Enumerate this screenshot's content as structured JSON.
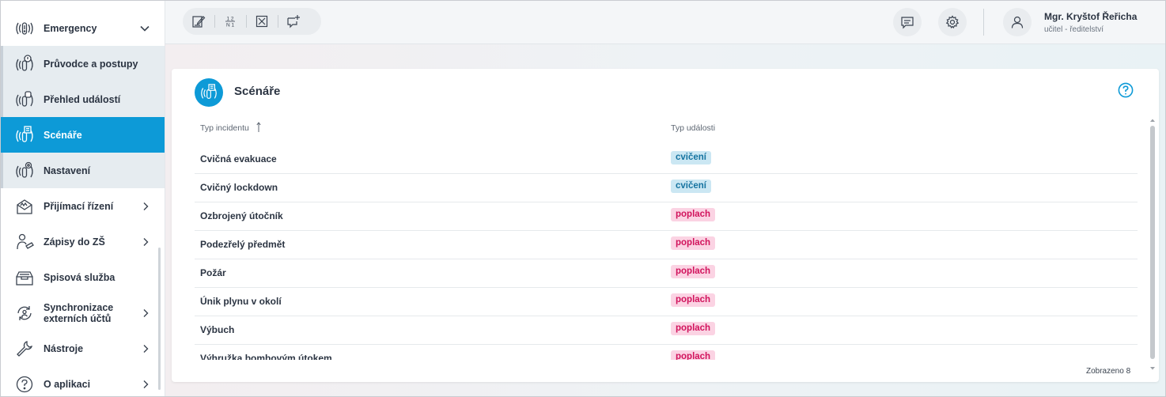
{
  "sidebar": {
    "items": [
      {
        "label": "Emergency",
        "icon": "emergency-icon"
      },
      {
        "label": "Průvodce a postupy",
        "icon": "guide-icon"
      },
      {
        "label": "Přehled událostí",
        "icon": "events-icon"
      },
      {
        "label": "Scénáře",
        "icon": "scenarios-icon"
      },
      {
        "label": "Nastavení",
        "icon": "settings-emergency-icon"
      },
      {
        "label": "Přijímací řízení",
        "icon": "admission-icon"
      },
      {
        "label": "Zápisy do ZŠ",
        "icon": "enrollment-icon"
      },
      {
        "label": "Spisová služba",
        "icon": "filing-icon"
      },
      {
        "label": "Synchronizace externích účtů",
        "icon": "sync-icon"
      },
      {
        "label": "Nástroje",
        "icon": "wrench-icon"
      },
      {
        "label": "O aplikaci",
        "icon": "question-icon"
      }
    ]
  },
  "topbar": {
    "tools": [
      "edit-icon",
      "grades-icon",
      "absence-icon",
      "add-message-icon"
    ],
    "user": {
      "name": "Mgr. Kryštof Řeřicha",
      "role": "učitel - ředitelství"
    }
  },
  "card": {
    "title": "Scénáře",
    "columns": {
      "type": "Typ incidentu",
      "event": "Typ události"
    },
    "rows": [
      {
        "name": "Cvičná evakuace",
        "badge": "cvičení",
        "kind": "exercise"
      },
      {
        "name": "Cvičný lockdown",
        "badge": "cvičení",
        "kind": "exercise"
      },
      {
        "name": "Ozbrojený útočník",
        "badge": "poplach",
        "kind": "alarm"
      },
      {
        "name": "Podezřelý předmět",
        "badge": "poplach",
        "kind": "alarm"
      },
      {
        "name": "Požár",
        "badge": "poplach",
        "kind": "alarm"
      },
      {
        "name": "Únik plynu v okolí",
        "badge": "poplach",
        "kind": "alarm"
      },
      {
        "name": "Výbuch",
        "badge": "poplach",
        "kind": "alarm"
      },
      {
        "name": "Výhružka bombovým útokem",
        "badge": "poplach",
        "kind": "alarm"
      }
    ],
    "footer": "Zobrazeno 8"
  },
  "colors": {
    "accent": "#0d9ad7",
    "exercise_bg": "#cbe7f3",
    "alarm_bg": "#fbd3e3",
    "alarm_text": "#d1135c"
  }
}
